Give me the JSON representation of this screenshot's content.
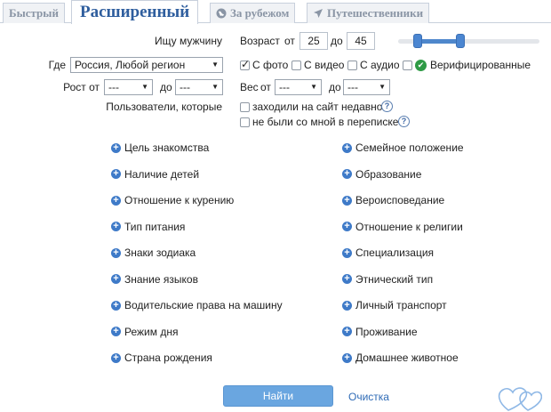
{
  "tabs": [
    {
      "label": "Быстрый",
      "icon": ""
    },
    {
      "label": "Расширенный",
      "icon": ""
    },
    {
      "label": "За рубежом",
      "icon": "globe-icon"
    },
    {
      "label": "Путешественники",
      "icon": "plane-icon"
    }
  ],
  "search": {
    "seeking_label": "Ищу мужчину",
    "age_label": "Возраст",
    "age_from_label": "от",
    "age_from": "25",
    "age_to_label": "до",
    "age_to": "45",
    "where_label": "Где",
    "region": "Россия, Любой регион",
    "height_label": "Рост от",
    "height_from": "---",
    "height_to_label": "до",
    "height_to": "---",
    "weight_label": "Вес",
    "weight_from_label": "от",
    "weight_from": "---",
    "weight_to_label": "до",
    "weight_to": "---",
    "users_label": "Пользователи, которые"
  },
  "age_slider": {
    "min": 18,
    "max": 80,
    "from": 25,
    "to": 45
  },
  "checkboxes": {
    "with_photo": {
      "label": "С фото",
      "checked": true
    },
    "with_video": {
      "label": "С видео",
      "checked": false
    },
    "with_audio": {
      "label": "С аудио",
      "checked": false
    },
    "verified": {
      "label": "Верифицированные",
      "checked": false
    }
  },
  "user_filters": [
    {
      "label": "заходили на сайт недавно",
      "checked": false
    },
    {
      "label": "не были со мной в переписке",
      "checked": false
    }
  ],
  "help_symbol": "?",
  "filters_left": [
    "Цель знакомства",
    "Наличие детей",
    "Отношение к курению",
    "Тип питания",
    "Знаки зодиака",
    "Знание языков",
    "Водительские права на машину",
    "Режим дня",
    "Страна рождения"
  ],
  "filters_right": [
    "Семейное положение",
    "Образование",
    "Вероисповедание",
    "Отношение к религии",
    "Специализация",
    "Этнический тип",
    "Личный транспорт",
    "Проживание",
    "Домашнее животное"
  ],
  "actions": {
    "find": "Найти",
    "clear": "Очистка"
  },
  "colors": {
    "accent": "#3e7ac8",
    "button": "#6aa6e0",
    "verified": "#2e9a45",
    "tab_active": "#2f5e9e"
  }
}
